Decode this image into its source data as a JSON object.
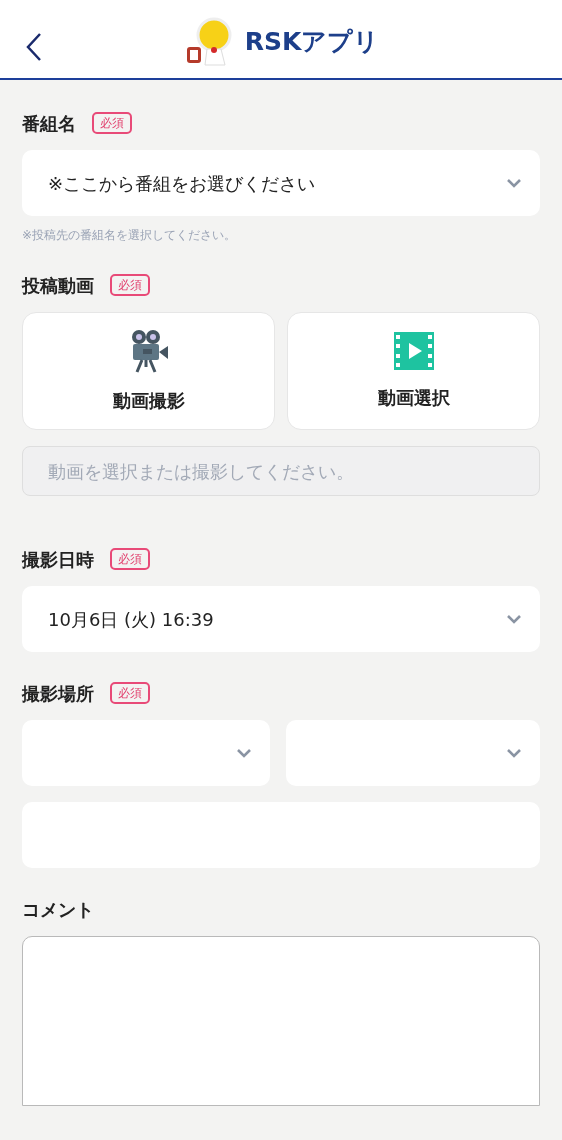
{
  "header": {
    "title": "RSKアプリ"
  },
  "sections": [
    {
      "kind": "select",
      "label": "番組名",
      "badge": "必須",
      "value": "※ここから番組をお選びください",
      "hint": "※投稿先の番組名を選択してください。"
    },
    {
      "kind": "video",
      "label": "投稿動画",
      "badge": "必須",
      "buttons": [
        "動画撮影",
        "動画選択"
      ],
      "placeholder": "動画を選択または撮影してください。"
    },
    {
      "kind": "select",
      "label": "撮影日時",
      "badge": "必須",
      "value": "10月6日 (火) 16:39"
    },
    {
      "kind": "location",
      "label": "撮影場所",
      "badge": "必須"
    },
    {
      "kind": "textarea",
      "label": "コメント"
    }
  ]
}
